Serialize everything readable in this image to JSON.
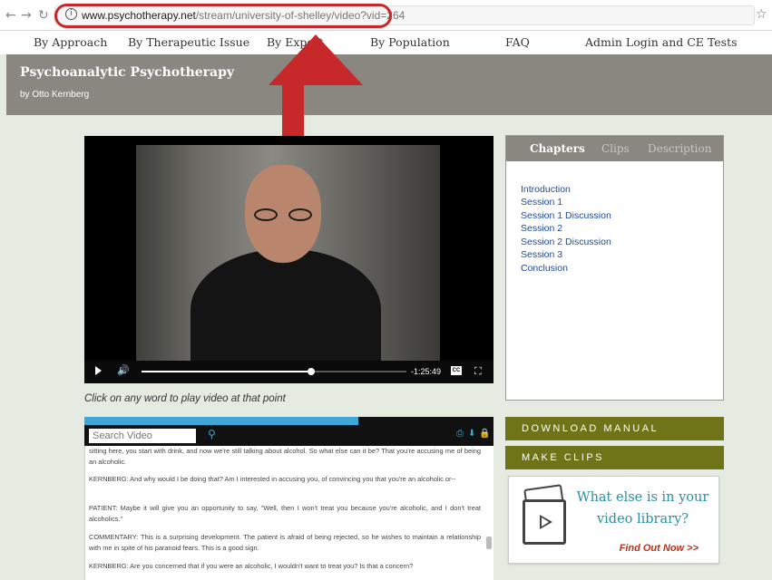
{
  "browser": {
    "url_domain": "www.psychotherapy.net",
    "url_path": "/stream/university-of-shelley/video?vid=264",
    "back_icon": "arrow-left",
    "forward_icon": "arrow-right",
    "reload_icon": "reload",
    "info_icon": "info-circle",
    "bookmark_icon": "star"
  },
  "nav": {
    "items": [
      {
        "label": "By Approach"
      },
      {
        "label": "By Therapeutic Issue"
      },
      {
        "label": "By Expert"
      },
      {
        "label": "By Population"
      },
      {
        "label": "FAQ"
      },
      {
        "label": "Admin Login and CE Tests"
      }
    ]
  },
  "header": {
    "title": "Psychoanalytic Psychotherapy",
    "subtitle": "by Otto Kernberg"
  },
  "video": {
    "time_remaining": "-1:25:49",
    "progress": 0.64,
    "cc_label": "CC"
  },
  "transcript": {
    "caption": "Click on any word to play video at that point",
    "search_placeholder": "Search Video",
    "progress": 0.67,
    "lines": [
      "sitting here, you start with drink, and now we're still talking about alcohol. So what else can it be? That you're accusing me of being an alcoholic.",
      "KERNBERG: And why would I be doing that? Am I interested in accusing you, of convincing you that you're an alcoholic or--",
      "PATIENT: Maybe it will give you an opportunity to say, \"Well, then I won't treat you because you're alcoholic, and I don't treat alcoholics.\"",
      "COMMENTARY: This is a surprising development. The patient is afraid of being rejected, so he wishes to maintain a relationship with me in spite of his paranoid fears. This is a good sign.",
      "KERNBERG: Are you concerned that if you were an alcoholic, I wouldn't want to treat you? Is that a concern?"
    ]
  },
  "panel": {
    "tabs": [
      {
        "label": "Chapters",
        "active": true
      },
      {
        "label": "Clips",
        "active": false
      },
      {
        "label": "Description",
        "active": false
      }
    ],
    "chapters": [
      "Introduction",
      "Session 1",
      "Session 1 Discussion",
      "Session 2",
      "Session 2 Discussion",
      "Session 3",
      "Conclusion"
    ]
  },
  "buttons": {
    "download_manual": "DOWNLOAD MANUAL",
    "make_clips": "MAKE CLIPS"
  },
  "library": {
    "line1": "What else is in your",
    "line2": "video library?",
    "link": "Find Out Now >>"
  },
  "colors": {
    "annotation_red": "#c7282a",
    "header_gray": "#8a8680",
    "olive": "#6e7417",
    "link_blue": "#1f4aa0",
    "teal": "#2a8ea7",
    "accent_blue": "#3fa6d8",
    "page_bg": "#e5ebe0"
  }
}
